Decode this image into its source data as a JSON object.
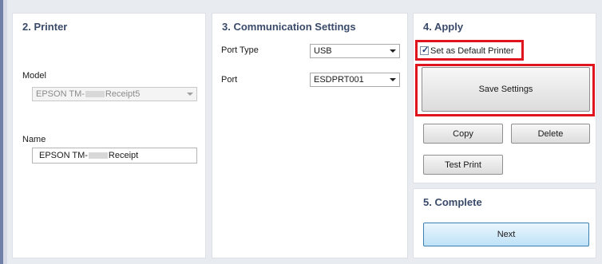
{
  "printer": {
    "title": "2. Printer",
    "model_label": "Model",
    "model_value_prefix": "EPSON TM-",
    "model_value_suffix": "Receipt5",
    "name_label": "Name",
    "name_value_prefix": "EPSON TM-",
    "name_value_suffix": "Receipt"
  },
  "comm": {
    "title": "3. Communication Settings",
    "port_type_label": "Port Type",
    "port_type_value": "USB",
    "port_label": "Port",
    "port_value": "ESDPRT001"
  },
  "apply": {
    "title": "4. Apply",
    "default_checkbox_label": "Set as Default Printer",
    "default_checked": true,
    "save_button": "Save Settings",
    "copy_button": "Copy",
    "delete_button": "Delete",
    "test_print_button": "Test Print"
  },
  "complete": {
    "title": "5. Complete",
    "next_button": "Next"
  },
  "colors": {
    "highlight": "#e0141e",
    "title_text": "#3a4a6a"
  }
}
